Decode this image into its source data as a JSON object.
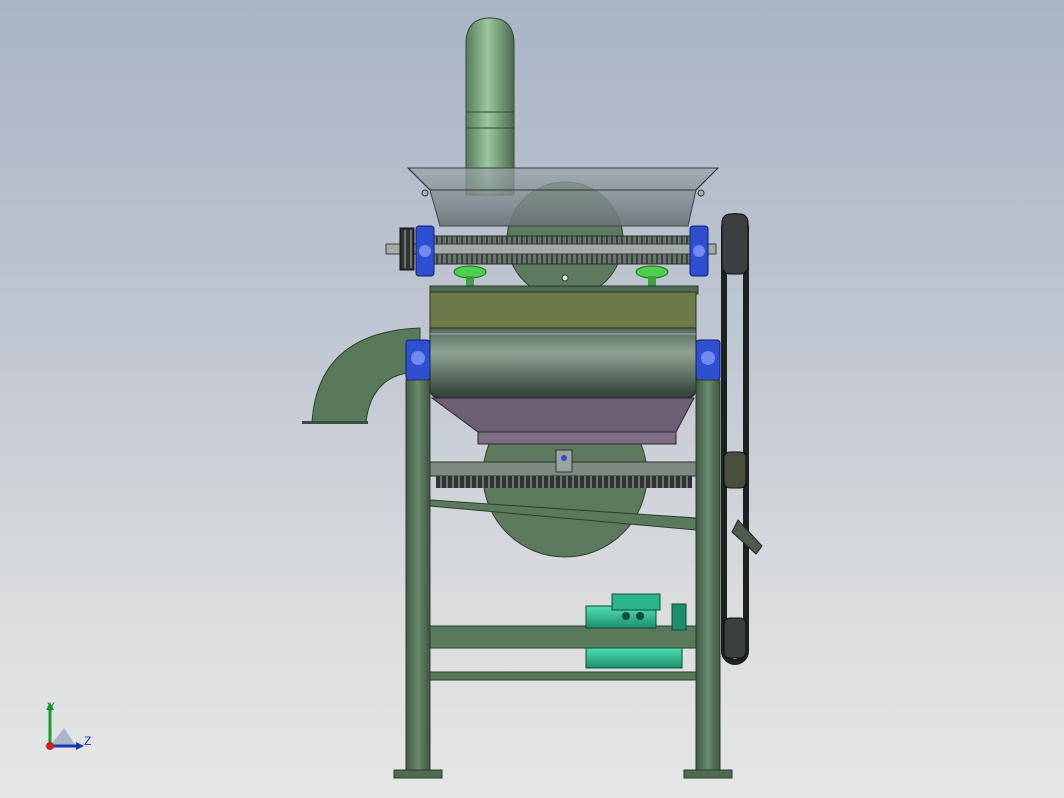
{
  "window": {
    "title": ""
  },
  "triad": {
    "y_label": "Y",
    "z_label": "Z"
  },
  "colors": {
    "frame": "#5d7d5f",
    "frame_dark": "#3f5a42",
    "metal_grey": "#6e7a72",
    "bearing_blue": "#2d4fd0",
    "motor_teal": "#2ec39a",
    "hopper_glass": "#7f8b8e",
    "tray_purple": "#6a5a70",
    "belt_black": "#1d2220"
  },
  "model": {
    "name_icon": "threshing-machine-model",
    "parts": [
      "chimney-pipe",
      "feed-hopper",
      "spiked-roller",
      "drum-housing",
      "discharge-elbow",
      "screen-tray",
      "belt-drive",
      "electric-motor",
      "support-frame"
    ]
  }
}
